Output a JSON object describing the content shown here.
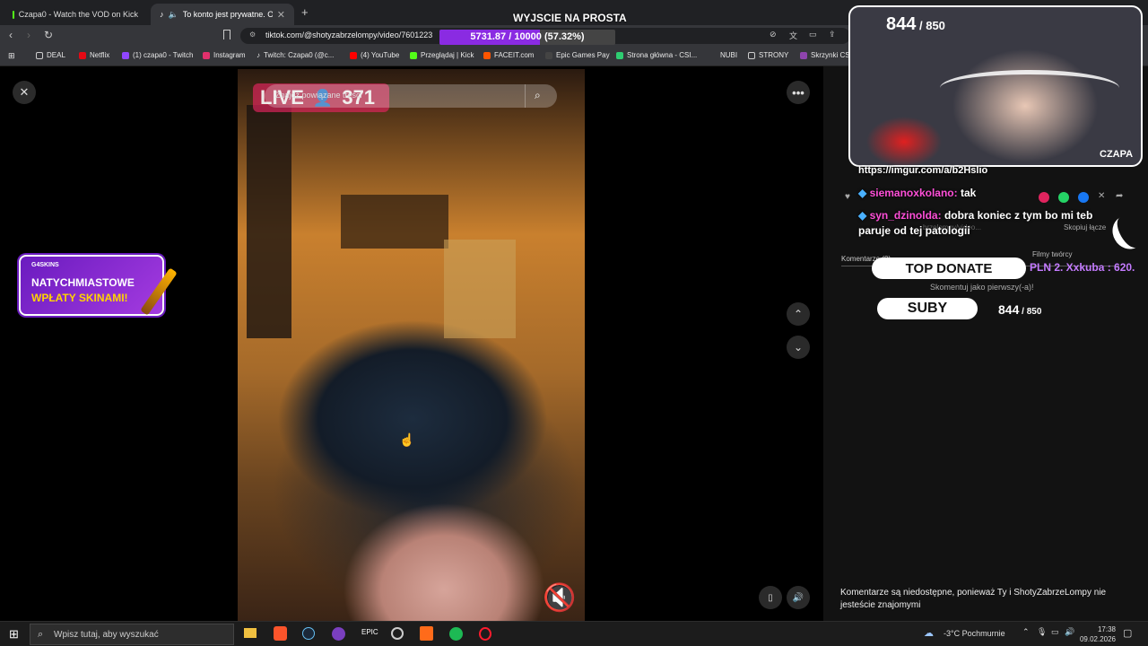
{
  "tabs": [
    {
      "title": "Czapa0 - Watch the VOD on Kick"
    },
    {
      "title": "To konto jest prywatne. Obse"
    }
  ],
  "address": {
    "url": "tiktok.com/@shotyzabrzelompy/video/7601223"
  },
  "bookmarks": [
    "DEAL",
    "Netflix",
    "(1) czapa0 - Twitch",
    "Instagram",
    "Twitch: Czapa0 (@c...",
    "(4) YouTube",
    "Przeglądaj | Kick",
    "FACEIT.com",
    "Epic Games Pay",
    "Strona główna - CSI...",
    "NUBI",
    "STRONY",
    "Skrzynki CS"
  ],
  "overlay": {
    "goal_title": "WYJSCIE NA PROSTA",
    "goal_progress": "5731.87 / 10000 (57.32%)",
    "goal_fraction": 0.5732,
    "sub_count": "844",
    "sub_target": "850",
    "cam_name": "CZAPA",
    "promo_line1": "NATYCHMIASTOWE",
    "promo_line2": "WPŁATY SKINAMI!",
    "promo_brand": "G4SKINS",
    "chat": [
      {
        "user": "siemanoxkolano:",
        "msg": "tak",
        "color": "#ff4fd8"
      },
      {
        "user": "syn_dzinolda:",
        "msg": "dobra koniec z tym bo mi teb paruje od tej patologii",
        "color": "#ff4fd8"
      }
    ],
    "chat_link": "https://imgur.com/a/b2Hslio",
    "top_donate_label": "TOP DONATE",
    "top_donate_entry": "PLN 2. Xxkuba : 620.",
    "suby_label": "SUBY",
    "suby_count": "844",
    "suby_target": "850"
  },
  "video": {
    "live_label": "LIVE",
    "viewers": "371",
    "search_placeholder": "Znajdź powiązane treści"
  },
  "right_pane": {
    "comments_label": "Komentarze (0)",
    "creator_videos_label": "Filmy twórcy",
    "first_comment": "Skomentuj jako pierwszy(-a)!",
    "copy_link": "Skopiuj łącze",
    "link_fragment": "brzelompy/video...",
    "disabled_msg": "Komentarze są niedostępne, ponieważ Ty i ShotyZabrzeLompy nie jesteście znajomymi"
  },
  "taskbar": {
    "search_placeholder": "Wpisz tutaj, aby wyszukać",
    "weather": "-3°C  Pochmurnie",
    "time": "17:38",
    "date": "09.02.2026"
  },
  "colors": {
    "accent": "#8a2be2",
    "live": "#e0245e",
    "kick": "#53fc18"
  }
}
